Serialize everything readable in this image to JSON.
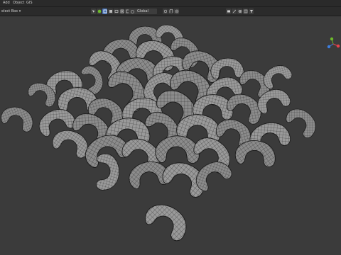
{
  "menu": {
    "items": [
      "Add",
      "Object",
      "GIS"
    ]
  },
  "header": {
    "select_mode": "elect Box ▾",
    "pivot": "Global"
  },
  "colors": {
    "viewport_bg": "#3b3b3b",
    "mesh_fill": "#8f8f8f",
    "mesh_wire": "#222222",
    "accent": "#4772b3",
    "axis_x": "#e8424b",
    "axis_y": "#6dbb2a",
    "axis_z": "#3d7fe0"
  },
  "icons": [
    "cursor-icon",
    "select-icon",
    "move-icon",
    "rotate-icon",
    "scale-icon",
    "snap-icon",
    "proportional-icon",
    "filter-icon",
    "camera-icon",
    "grid-icon"
  ]
}
